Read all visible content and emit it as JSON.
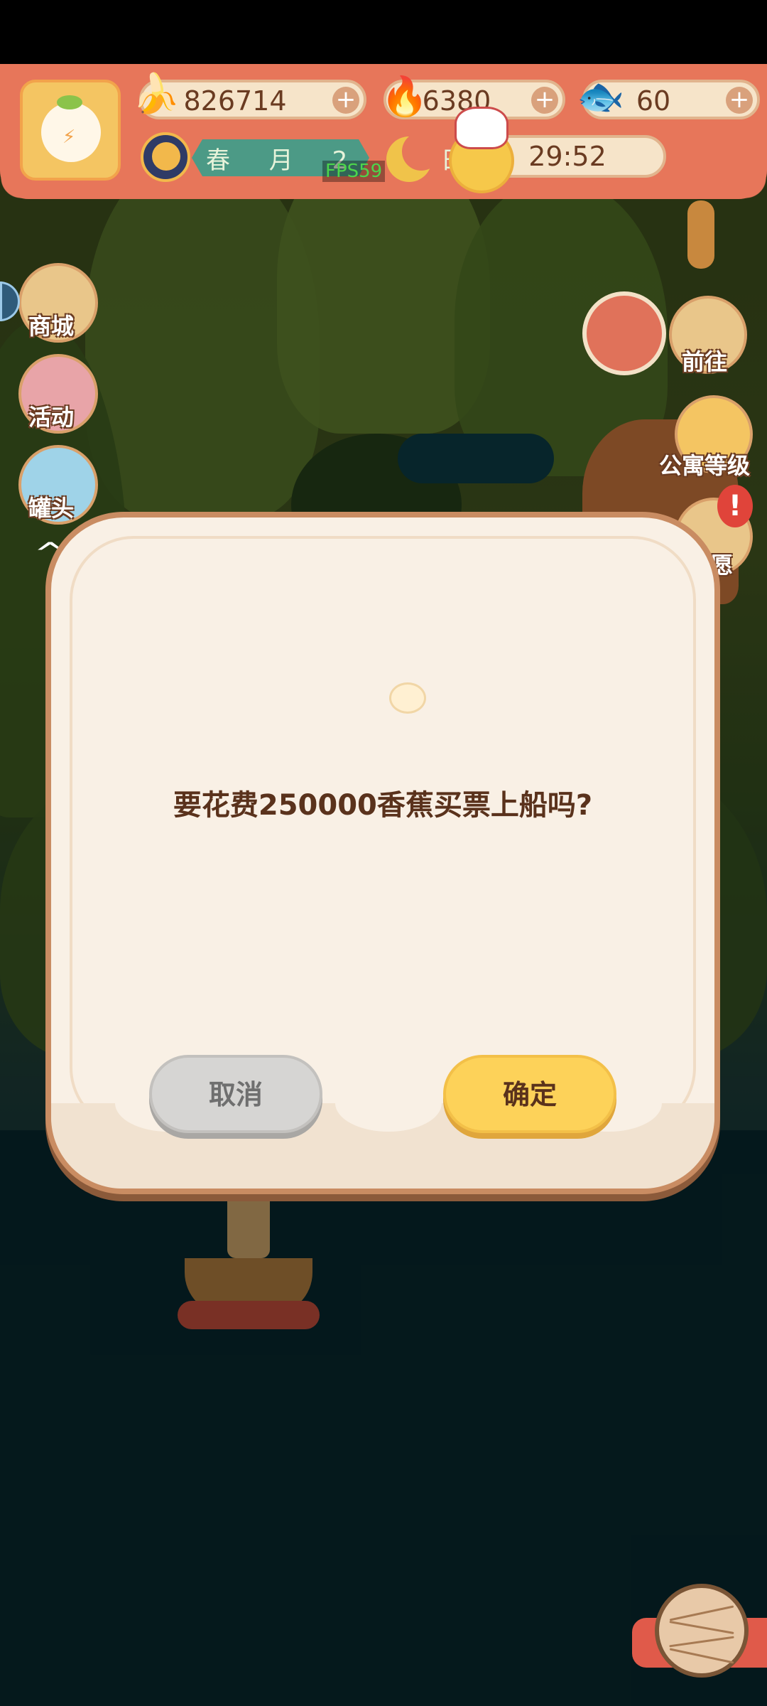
{
  "hud": {
    "bananas": "826714",
    "flames": "6380",
    "fish": "60",
    "date": "春 月 2 4 日",
    "fps": "FPS59",
    "timer": "29:52"
  },
  "side_menu": {
    "shop": "商城",
    "event": "活动",
    "can": "罐头",
    "go": "前往",
    "apartment_level": "公寓等级",
    "wish": "愿"
  },
  "dialog": {
    "message": "要花费250000香蕉买票上船吗?",
    "cancel": "取消",
    "confirm": "确定"
  },
  "icons": {
    "banana": "banana-icon",
    "flame": "flame-icon",
    "fish": "fish-icon",
    "plus": "plus-icon"
  },
  "colors": {
    "hud": "#e7765a",
    "dialog_bg": "#f9f0e5",
    "confirm": "#fdd259",
    "cancel": "#d6d5d3"
  }
}
